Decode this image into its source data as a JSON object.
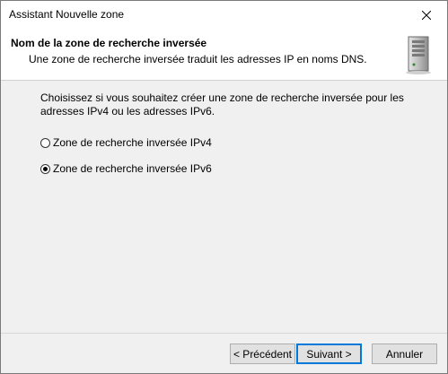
{
  "window": {
    "title": "Assistant Nouvelle zone"
  },
  "header": {
    "title": "Nom de la zone de recherche inversée",
    "subtitle": "Une zone de recherche inversée traduit les adresses IP en noms DNS."
  },
  "content": {
    "description": "Choisissez si vous souhaitez créer une zone de recherche inversée pour les adresses IPv4 ou les adresses IPv6.",
    "options": [
      {
        "label": "Zone de recherche inversée IPv4",
        "selected": false
      },
      {
        "label": "Zone de recherche inversée IPv6",
        "selected": true
      }
    ]
  },
  "buttons": {
    "back": "< Précédent",
    "next": "Suivant >",
    "cancel": "Annuler"
  },
  "icons": {
    "close": "close-icon",
    "server": "server-icon"
  }
}
